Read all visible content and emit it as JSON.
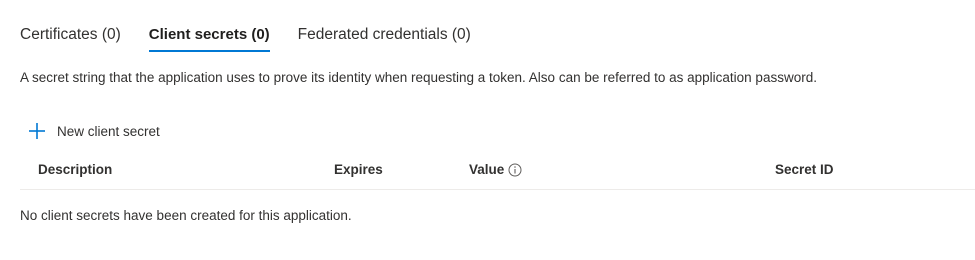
{
  "tabs": [
    {
      "label": "Certificates (0)",
      "active": false
    },
    {
      "label": "Client secrets (0)",
      "active": true
    },
    {
      "label": "Federated credentials (0)",
      "active": false
    }
  ],
  "description": "A secret string that the application uses to prove its identity when requesting a token. Also can be referred to as application password.",
  "toolbar": {
    "new_secret_label": "New client secret",
    "new_secret_icon": "plus-icon"
  },
  "table": {
    "columns": {
      "description": "Description",
      "expires": "Expires",
      "value": "Value",
      "value_icon": "info-icon",
      "secret_id": "Secret ID"
    },
    "rows": [],
    "empty_message": "No client secrets have been created for this application."
  },
  "colors": {
    "accent": "#0078d4",
    "text": "#323130",
    "divider": "#edebe9"
  }
}
